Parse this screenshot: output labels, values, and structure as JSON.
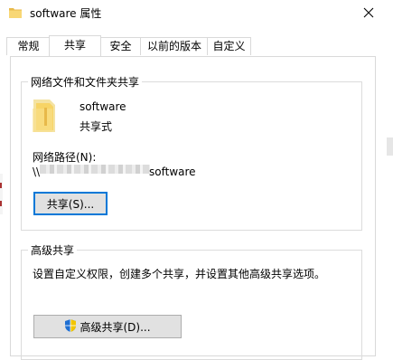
{
  "window": {
    "title": "software 属性",
    "folder_icon": "folder-icon",
    "close_icon": "close-icon"
  },
  "tabs": [
    {
      "label": "常规",
      "active": false
    },
    {
      "label": "共享",
      "active": true
    },
    {
      "label": "安全",
      "active": false
    },
    {
      "label": "以前的版本",
      "active": false
    },
    {
      "label": "自定义",
      "active": false
    }
  ],
  "share_group": {
    "title": "网络文件和文件夹共享",
    "item_name": "software",
    "item_status": "共享式",
    "path_label": "网络路径(N):",
    "path_prefix": "\\\\",
    "path_suffix": "software",
    "share_button": "共享(S)..."
  },
  "advanced_group": {
    "title": "高级共享",
    "description": "设置自定义权限，创建多个共享，并设置其他高级共享选项。",
    "button": "高级共享(D)...",
    "button_icon": "shield-icon"
  }
}
